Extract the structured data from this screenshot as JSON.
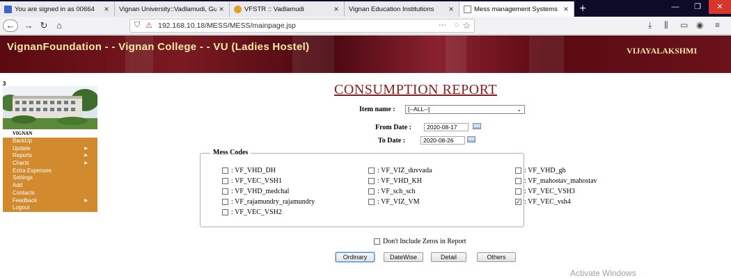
{
  "browser": {
    "tabs": [
      {
        "title": "You are signed in as 00664",
        "active": false
      },
      {
        "title": "Vignan University::Vadlamudi, Gun",
        "active": false
      },
      {
        "title": "VFSTR :: Vadlamudi",
        "active": false
      },
      {
        "title": "Vignan Education Institutions",
        "active": false
      },
      {
        "title": "Mess management Systems",
        "active": true
      }
    ],
    "url": "192.168.10.18/MESS/MESS/mainpage.jsp",
    "url_more_label": "···"
  },
  "header": {
    "title": "VignanFoundation - - Vignan College - - VU (Ladies Hostel)",
    "user": "VIJAYALAKSHMI"
  },
  "sidebar": {
    "counter": "3",
    "image_caption": "VIGNAN",
    "items": [
      {
        "label": "BackUp",
        "has_submenu": false
      },
      {
        "label": "Update",
        "has_submenu": true
      },
      {
        "label": "Reports",
        "has_submenu": true
      },
      {
        "label": "Charts",
        "has_submenu": true
      },
      {
        "label": "Extra Expenses",
        "has_submenu": false
      },
      {
        "label": "Settings",
        "has_submenu": false
      },
      {
        "label": "Add",
        "has_submenu": false
      },
      {
        "label": "Contacts",
        "has_submenu": false
      },
      {
        "label": "Feedback",
        "has_submenu": true
      },
      {
        "label": "Logout",
        "has_submenu": false
      }
    ]
  },
  "report": {
    "title": "CONSUMPTION REPORT",
    "item_name_label": "Item name :",
    "item_name_value": "[--ALL--]",
    "from_date_label": "From Date :",
    "from_date_value": "2020-08-17",
    "to_date_label": "To Date :",
    "to_date_value": "2020-08-26",
    "mess_codes_label": "Mess Codes",
    "mess_codes": [
      {
        "label": ": VF_VHD_DH",
        "checked": false
      },
      {
        "label": ": VF_VIZ_duvvada",
        "checked": false
      },
      {
        "label": ": VF_VHD_gh",
        "checked": false
      },
      {
        "label": ": VF_VEC_VSH1",
        "checked": false
      },
      {
        "label": ": VF_VHD_KH",
        "checked": false
      },
      {
        "label": ": VF_mahostav_mahostav",
        "checked": false
      },
      {
        "label": ": VF_VHD_medchal",
        "checked": false
      },
      {
        "label": ": VF_sch_sch",
        "checked": false
      },
      {
        "label": ": VF_VEC_VSH3",
        "checked": false
      },
      {
        "label": ": VF_rajamundry_rajamundry",
        "checked": false
      },
      {
        "label": ": VF_VIZ_VM",
        "checked": false
      },
      {
        "label": ": VF_VEC_vsh4",
        "checked": true
      },
      {
        "label": ": VF_VEC_VSH2",
        "checked": false
      }
    ],
    "exclude_zeros_label": "Don't Include Zeros in Report",
    "exclude_zeros_checked": false,
    "buttons": {
      "ordinary": "Ordinary",
      "datewise": "DateWise",
      "detail": "Detail",
      "others": "Others"
    }
  },
  "watermark": "Activate Windows",
  "colors": {
    "banner": "#6a121a",
    "banner_text": "#f5e9a8",
    "menu_bg": "#d28a2e",
    "menu_selected": "#6b3a10",
    "title": "#8b1a1a"
  }
}
